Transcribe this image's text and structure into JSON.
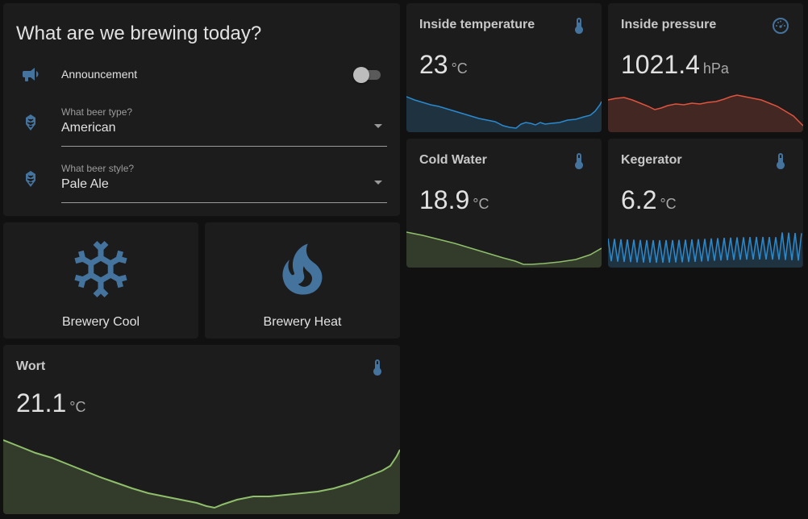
{
  "entities": {
    "title": "What are we brewing today?",
    "announcement": {
      "label": "Announcement",
      "icon": "bullhorn-icon",
      "state": "off"
    },
    "beer_type": {
      "label": "What beer type?",
      "value": "American",
      "icon": "hops-icon"
    },
    "beer_style": {
      "label": "What beer style?",
      "value": "Pale Ale",
      "icon": "hops-icon"
    }
  },
  "buttons": {
    "cool": {
      "label": "Brewery Cool",
      "icon": "snowflake-icon"
    },
    "heat": {
      "label": "Brewery Heat",
      "icon": "fire-icon"
    }
  },
  "sensors": {
    "inside_temp": {
      "name": "Inside temperature",
      "value": "23",
      "unit": "°C",
      "icon": "thermometer-icon",
      "color": "#2a8ad0"
    },
    "inside_pressure": {
      "name": "Inside pressure",
      "value": "1021.4",
      "unit": "hPa",
      "icon": "gauge-icon",
      "color": "#e0533f"
    },
    "cold_water": {
      "name": "Cold Water",
      "value": "18.9",
      "unit": "°C",
      "icon": "thermometer-icon",
      "color": "#8fbf6b"
    },
    "kegerator": {
      "name": "Kegerator",
      "value": "6.2",
      "unit": "°C",
      "icon": "thermometer-icon",
      "color": "#2a8ad0"
    },
    "wort": {
      "name": "Wort",
      "value": "21.1",
      "unit": "°C",
      "icon": "thermometer-icon",
      "color": "#8fbf6b"
    }
  },
  "colors": {
    "accent": "#44739e",
    "card_background": "#1c1c1c",
    "page_background": "#111111"
  }
}
